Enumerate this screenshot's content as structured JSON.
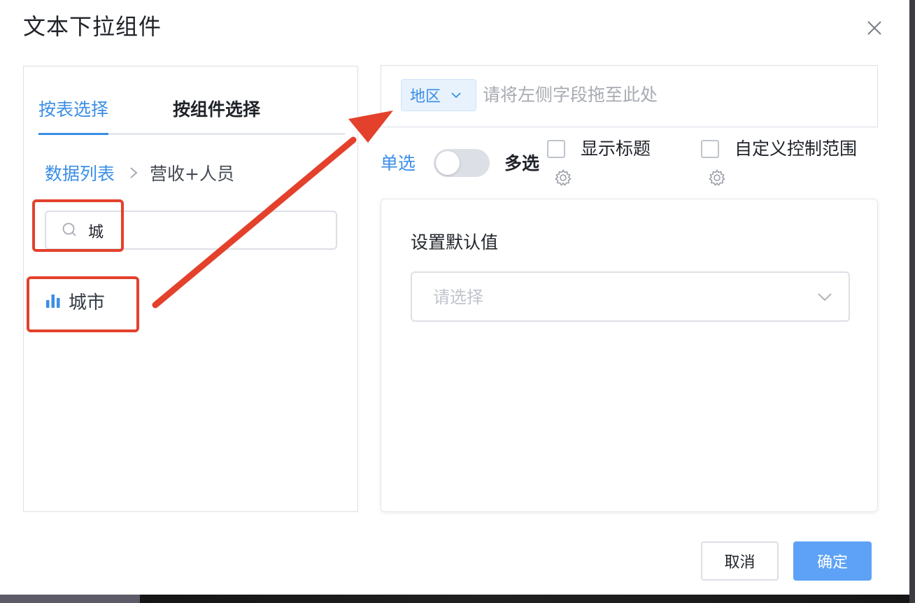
{
  "dialog": {
    "title": "文本下拉组件"
  },
  "left_panel": {
    "tabs": [
      {
        "label": "按表选择",
        "active": true
      },
      {
        "label": "按组件选择",
        "active": false
      }
    ],
    "breadcrumb": {
      "root": "数据列表",
      "current": "营收+人员"
    },
    "search": {
      "value": "城",
      "placeholder": ""
    },
    "fields": [
      {
        "label": "城市",
        "icon": "bar-chart-icon"
      }
    ]
  },
  "drop_zone": {
    "tag_label": "地区",
    "placeholder": "请将左侧字段拖至此处"
  },
  "options": {
    "single_label": "单选",
    "multi_label": "多选",
    "switch_on": false,
    "show_title_label": "显示标题",
    "custom_range_label": "自定义控制范围"
  },
  "default_value": {
    "title": "设置默认值",
    "select_placeholder": "请选择"
  },
  "footer": {
    "cancel_label": "取消",
    "confirm_label": "确定"
  },
  "colors": {
    "accent": "#3a8ee6",
    "annotation": "#e3412c",
    "confirm_bg": "#5da2f6"
  }
}
